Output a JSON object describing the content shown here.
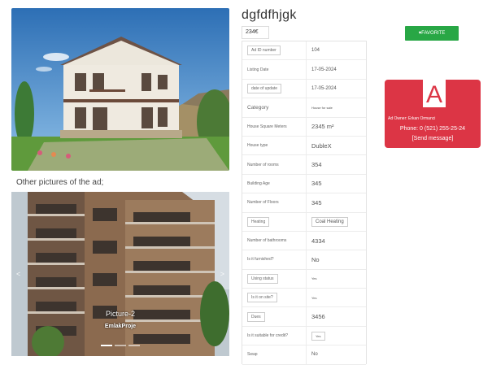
{
  "listing": {
    "title": "dgfdfhjgk",
    "price": "234€",
    "favorite_label": "♥FAVORITE"
  },
  "gallery": {
    "heading": "Other pictures of the ad;",
    "caption": "Picture-2",
    "subcaption": "EmlakProje",
    "prev_icon": "<",
    "next_icon": ">"
  },
  "details": [
    {
      "label": "Ad ID number",
      "value": "104"
    },
    {
      "label": "Listing Date",
      "value": "17-05-2024"
    },
    {
      "label": "date of update",
      "value": "17-05-2024"
    },
    {
      "label": "Category",
      "value": "House for sale"
    },
    {
      "label": "House Square Meters",
      "value": "2345 m²"
    },
    {
      "label": "House type",
      "value": "DubleX"
    },
    {
      "label": "Number of rooms",
      "value": "354"
    },
    {
      "label": "Building Age",
      "value": "345"
    },
    {
      "label": "Number of Floors",
      "value": "345"
    },
    {
      "label": "Heating",
      "value": "Coal Heating"
    },
    {
      "label": "Number of bathrooms",
      "value": "4334"
    },
    {
      "label": "Is it furnished?",
      "value": "No"
    },
    {
      "label": "Using status",
      "value": "Yes"
    },
    {
      "label": "Is it on site?",
      "value": "Yes"
    },
    {
      "label": "Dues",
      "value": "3456"
    },
    {
      "label": "Is it suitable for credit?",
      "value": "Yes"
    },
    {
      "label": "Swap",
      "value": "No"
    }
  ],
  "owner": {
    "logo_letter": "A",
    "name": "Ad Owner: Erkan Ormanci",
    "phone": "Phone: 0 (521) 255-25-24",
    "send_label": "[Send message]"
  },
  "colors": {
    "favorite_green": "#28a745",
    "owner_red": "#dc3545"
  }
}
